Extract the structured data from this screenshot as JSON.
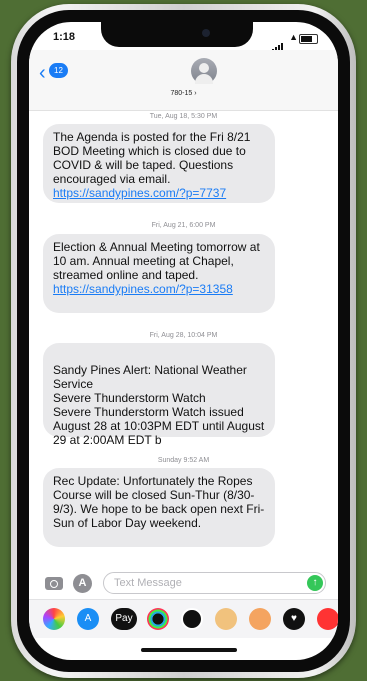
{
  "status_bar": {
    "time": "1:18"
  },
  "header": {
    "back_count": "12",
    "contact_name": "780-15"
  },
  "messages": [
    {
      "timestamp": "Tue, Aug 18, 5:30 PM",
      "text": "The Agenda is posted for the Fri 8/21 BOD Meeting which is closed due to COVID & will be taped. Questions encouraged via email.",
      "link": "https://sandypines.com/?p=7737"
    },
    {
      "timestamp": "Fri, Aug 21, 6:00 PM",
      "text": "Election & Annual Meeting tomorrow at 10 am. Annual meeting at Chapel, streamed online and taped.",
      "link": "https://sandypines.com/?p=31358"
    },
    {
      "timestamp": "Fri, Aug 28, 10:04 PM",
      "text": "Sandy Pines Alert: National Weather Service\n Severe Thunderstorm Watch\nSevere Thunderstorm Watch issued August 28 at 10:03PM EDT until August 29 at 2:00AM EDT b",
      "link": ""
    },
    {
      "timestamp": "Sunday 9:52 AM",
      "text": "Rec Update: Unfortunately the Ropes Course will be closed Sun-Thur (8/30-9/3). We hope to be back open next Fri-Sun of Labor Day weekend.",
      "link": ""
    }
  ],
  "input": {
    "placeholder": "Text Message"
  },
  "tray": {
    "apple_pay_label": "Pay",
    "icons": [
      "photos-icon",
      "app-store-icon",
      "apple-pay-icon",
      "activity-icon",
      "animoji-icon",
      "memoji-icon",
      "heart-sticker-icon",
      "more-apps-icon"
    ]
  },
  "colors": {
    "background": "#4f6e34",
    "accent": "#1a7cf5",
    "bubble": "#e9e9eb",
    "send": "#34c759"
  }
}
